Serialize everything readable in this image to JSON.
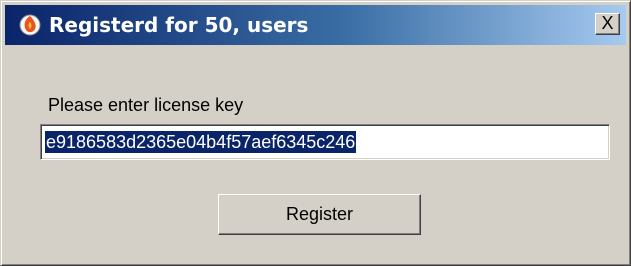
{
  "window": {
    "title": "Registerd for 50, users",
    "close_label": "X",
    "app_icon": "flame-app-icon"
  },
  "form": {
    "key_label": "Please enter license key",
    "key_value": "e9186583d2365e04b4f57aef6345c246",
    "register_label": "Register"
  },
  "colors": {
    "titlebar_start": "#0a246a",
    "titlebar_end": "#a6caf0",
    "dialog_face": "#d4d0c8",
    "selection": "#0a246a"
  }
}
